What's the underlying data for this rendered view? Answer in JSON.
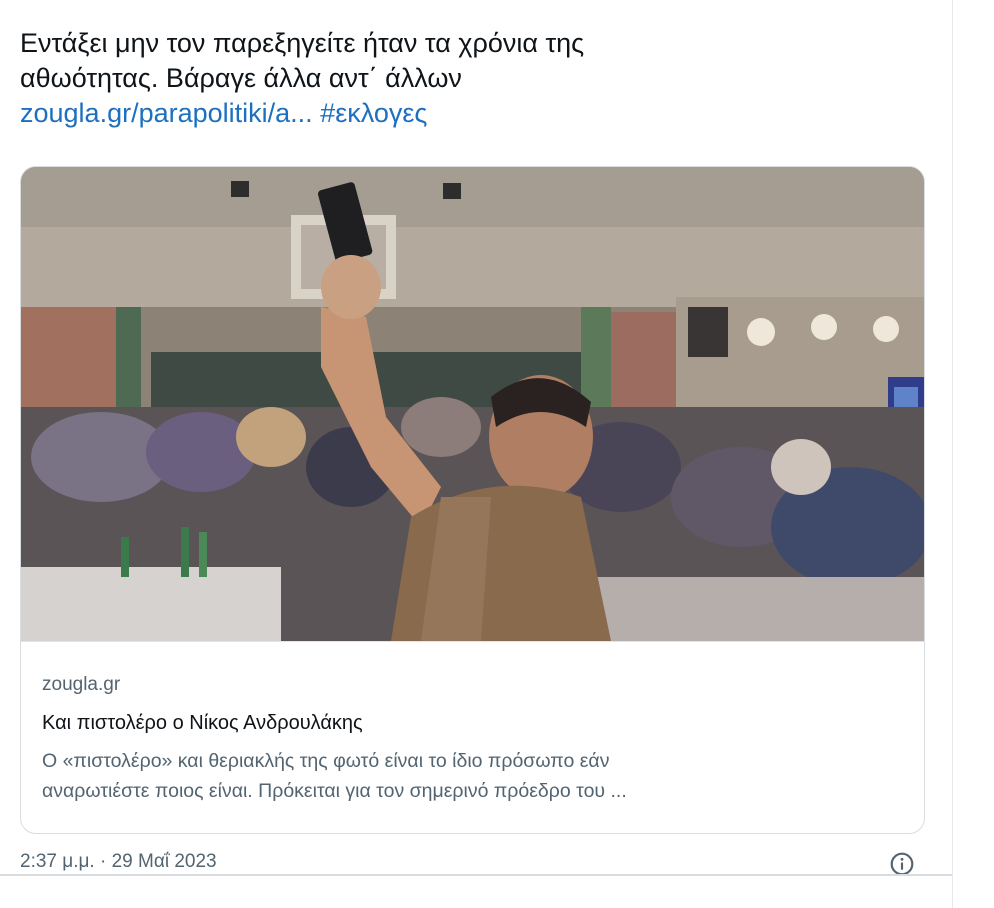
{
  "tweet": {
    "text_line1": "Εντάξει μην τον παρεξηγείτε  ήταν τα χρόνια της",
    "text_line2": "αθωότητας. Βάραγε άλλα αντ΄ άλλων",
    "link": "zougla.gr/parapolitiki/a...",
    "hashtag": "#εκλογες"
  },
  "card": {
    "image_icon": "photo-party-gun",
    "domain": "zougla.gr",
    "title": "Και πιστολέρο ο Νίκος Ανδρουλάκης",
    "desc_line1": "Ο «πιστολέρο» και θεριακλής της φωτό είναι το ίδιο πρόσωπο εάν",
    "desc_line2": "αναρωτιέστε ποιος είναι. Πρόκειται για τον σημερινό πρόεδρο του ..."
  },
  "footer": {
    "timestamp": "2:37 μ.μ. · 29 Μαΐ 2023",
    "info_icon": "info-circle-icon"
  },
  "colors": {
    "text": "#0f1419",
    "secondary": "#536471",
    "link": "#1d6fbf",
    "border": "#d8dde2"
  }
}
